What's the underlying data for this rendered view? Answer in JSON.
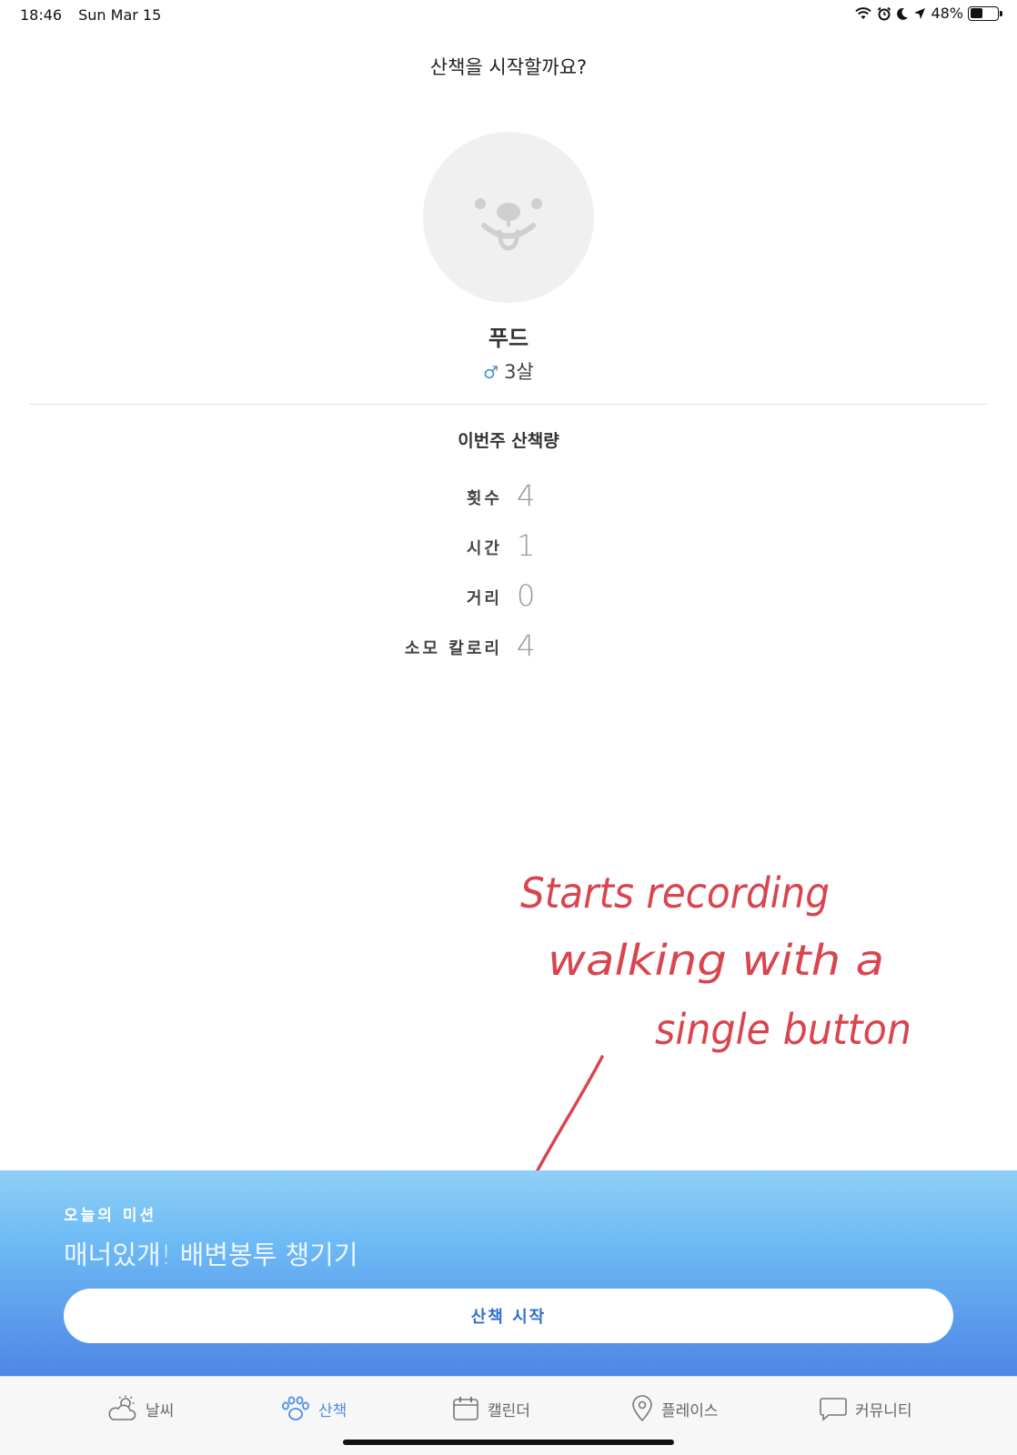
{
  "status_bar": {
    "time": "18:46",
    "date": "Sun Mar 15",
    "battery": "48%",
    "battery_level": 0.48,
    "icons": [
      "wifi-icon",
      "alarm-icon",
      "moon-icon",
      "location-arrow-icon",
      "battery-icon"
    ]
  },
  "header": {
    "title": "산책을 시작할까요?"
  },
  "pet": {
    "name": "푸드",
    "gender_symbol": "♂",
    "age": "3살",
    "avatar_icon": "dog-face-icon"
  },
  "weekly": {
    "title": "이번주 산책량",
    "stats": [
      {
        "label": "횟수",
        "value": "4"
      },
      {
        "label": "시간",
        "value": "1"
      },
      {
        "label": "거리",
        "value": "0"
      },
      {
        "label": "소모 칼로리",
        "value": "4"
      }
    ]
  },
  "annotation": {
    "lines": [
      "Starts recording",
      "walking with a",
      "single button"
    ],
    "color": "#d9454f"
  },
  "mission": {
    "label": "오늘의 미션",
    "text": "매너있개! 배변봉투 챙기기",
    "button_label": "산책 시작"
  },
  "tabs": [
    {
      "label": "날씨",
      "icon": "weather-icon",
      "active": false
    },
    {
      "label": "산책",
      "icon": "paw-icon",
      "active": true
    },
    {
      "label": "캘린더",
      "icon": "calendar-icon",
      "active": false
    },
    {
      "label": "플레이스",
      "icon": "location-pin-icon",
      "active": false
    },
    {
      "label": "커뮤니티",
      "icon": "chat-bubble-icon",
      "active": false
    }
  ],
  "colors": {
    "accent": "#4a90e2",
    "button_text": "#2f6fd6",
    "gradient_top": "#8fd0f5",
    "gradient_bottom": "#4f86e6"
  }
}
